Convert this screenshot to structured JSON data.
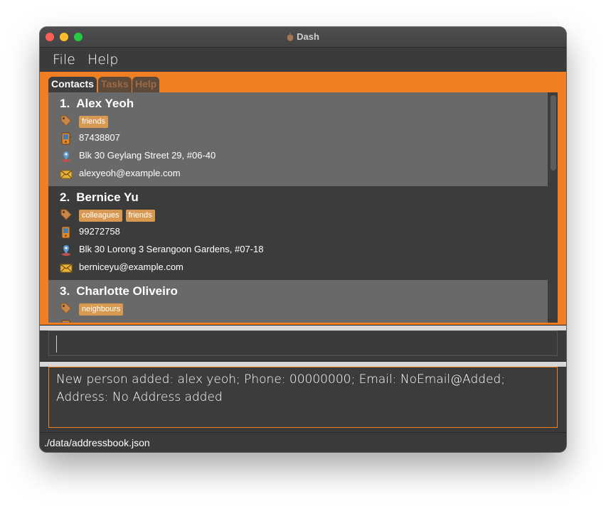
{
  "window": {
    "title": "Dash"
  },
  "menu": {
    "items": [
      "File",
      "Help"
    ]
  },
  "tabs": [
    {
      "label": "Contacts",
      "active": true
    },
    {
      "label": "Tasks",
      "active": false
    },
    {
      "label": "Help",
      "active": false
    }
  ],
  "contacts": [
    {
      "index": "1.",
      "name": "Alex Yeoh",
      "tags": [
        "friends"
      ],
      "phone": "87438807",
      "address": "Blk 30 Geylang Street 29, #06-40",
      "email": "alexyeoh@example.com"
    },
    {
      "index": "2.",
      "name": "Bernice Yu",
      "tags": [
        "colleagues",
        "friends"
      ],
      "phone": "99272758",
      "address": "Blk 30 Lorong 3 Serangoon Gardens, #07-18",
      "email": "berniceyu@example.com"
    },
    {
      "index": "3.",
      "name": "Charlotte Oliveiro",
      "tags": [
        "neighbours"
      ]
    }
  ],
  "command": {
    "value": ""
  },
  "result": {
    "message": "New person added: alex yeoh; Phone: 00000000; Email: NoEmail@Added; Address: No Address added"
  },
  "status": {
    "file_path": "./data/addressbook.json"
  },
  "icons": {
    "tag": "tag-icon",
    "phone": "phone-icon",
    "address": "location-pin-icon",
    "email": "envelope-icon"
  },
  "colors": {
    "accent": "#ef7f22",
    "tag_bg": "#d89a52",
    "card_light": "#696969",
    "card_dark": "#3c3c3c"
  }
}
